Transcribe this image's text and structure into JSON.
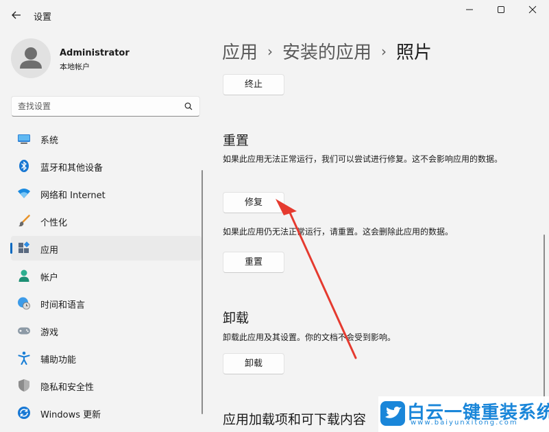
{
  "window": {
    "title": "设置",
    "controls": [
      "minimize-icon",
      "maximize-icon",
      "close-icon"
    ]
  },
  "profile": {
    "name": "Administrator",
    "account_type": "本地帐户"
  },
  "search": {
    "placeholder": "查找设置",
    "value": ""
  },
  "sidebar": {
    "items": [
      {
        "label": "系统",
        "icon": "monitor-icon"
      },
      {
        "label": "蓝牙和其他设备",
        "icon": "bluetooth-icon"
      },
      {
        "label": "网络和 Internet",
        "icon": "wifi-icon"
      },
      {
        "label": "个性化",
        "icon": "brush-icon"
      },
      {
        "label": "应用",
        "icon": "apps-icon",
        "selected": true
      },
      {
        "label": "帐户",
        "icon": "person-icon"
      },
      {
        "label": "时间和语言",
        "icon": "globe-clock-icon"
      },
      {
        "label": "游戏",
        "icon": "gamepad-icon"
      },
      {
        "label": "辅助功能",
        "icon": "accessibility-icon"
      },
      {
        "label": "隐私和安全性",
        "icon": "shield-icon"
      },
      {
        "label": "Windows 更新",
        "icon": "update-icon"
      }
    ]
  },
  "breadcrumb": {
    "items": [
      "应用",
      "安装的应用",
      "照片"
    ],
    "separator": "›"
  },
  "main": {
    "terminate_label": "终止",
    "reset_section": {
      "title": "重置",
      "repair_desc": "如果此应用无法正常运行，我们可以尝试进行修复。这不会影响应用的数据。",
      "repair_label": "修复",
      "reset_desc": "如果此应用仍无法正常运行，请重置。这会删除此应用的数据。",
      "reset_label": "重置"
    },
    "uninstall_section": {
      "title": "卸载",
      "desc": "卸载此应用及其设置。你的文档不会受到影响。",
      "uninstall_label": "卸载"
    },
    "addons_title": "应用加载项和可下载内容"
  },
  "watermark": {
    "text": "白云一键重装系统",
    "url": "www.baiyunxitong.com"
  },
  "colors": {
    "accent": "#0067c0",
    "annotation_arrow": "#e53a2f",
    "watermark": "#1a86d9"
  }
}
